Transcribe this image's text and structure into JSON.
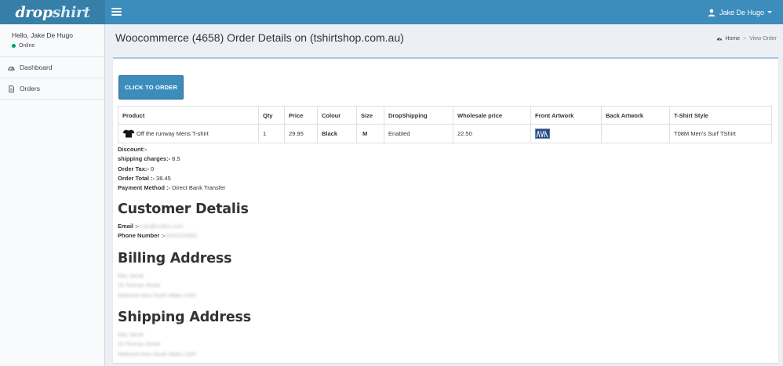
{
  "header": {
    "logo": {
      "part1": "drop",
      "part2": "shirt"
    },
    "user_name": "Jake De Hugo"
  },
  "sidebar": {
    "greeting": "Hello, Jake De Hugo",
    "status": "Online",
    "items": [
      {
        "label": "Dashboard",
        "icon": "dashboard-icon"
      },
      {
        "label": "Orders",
        "icon": "file-icon"
      }
    ]
  },
  "page": {
    "title": "Woocommerce (4658) Order Details on (tshirtshop.com.au)",
    "breadcrumb": {
      "home": "Home",
      "current": "View Order"
    }
  },
  "order_button": "CLICK TO ORDER",
  "table": {
    "columns": [
      "Product",
      "Qty",
      "Price",
      "Colour",
      "Size",
      "DropShipping",
      "Wholesale price",
      "Front Artwork",
      "Back Artwork",
      "T-Shirt Style"
    ],
    "row": {
      "product": "Off the runway Mens T-shirt",
      "qty": "1",
      "price": "29.95",
      "colour": "Black",
      "size": "M",
      "dropshipping": "Enabled",
      "wholesale": "22.50",
      "back_artwork": "",
      "style": "T08M Men's Surf TShirt"
    }
  },
  "totals": {
    "discount_label": "Discount:-",
    "discount_value": "",
    "shipping_label": "shipping charges:-",
    "shipping_value": " 8.5",
    "tax_label": "Order Tax:-",
    "tax_value": " 0",
    "total_label": "Order Total :-",
    "total_value": " 38.45",
    "payment_label": "Payment Method :-",
    "payment_value": " Direct Bank Transfer"
  },
  "customer": {
    "heading": "Customer Detalis",
    "email_label": "Email :-",
    "email_value": "mac@outlm.com",
    "phone_label": "Phone Number :-",
    "phone_value": "0432234892"
  },
  "billing": {
    "heading": "Billing Address",
    "lines": [
      "Mac Jacob",
      "23 Thomas Street",
      "Wallsend New South Wales 2287"
    ]
  },
  "shipping": {
    "heading": "Shipping Address",
    "lines": [
      "Mac Jacob",
      "23 Thomas Street",
      "Wallsend New South Wales 2287"
    ]
  },
  "colors": {
    "topbar": "#3c8dbc",
    "logo_bg": "#367fa9",
    "online": "#00a65a",
    "button": "#3c8dbc"
  }
}
